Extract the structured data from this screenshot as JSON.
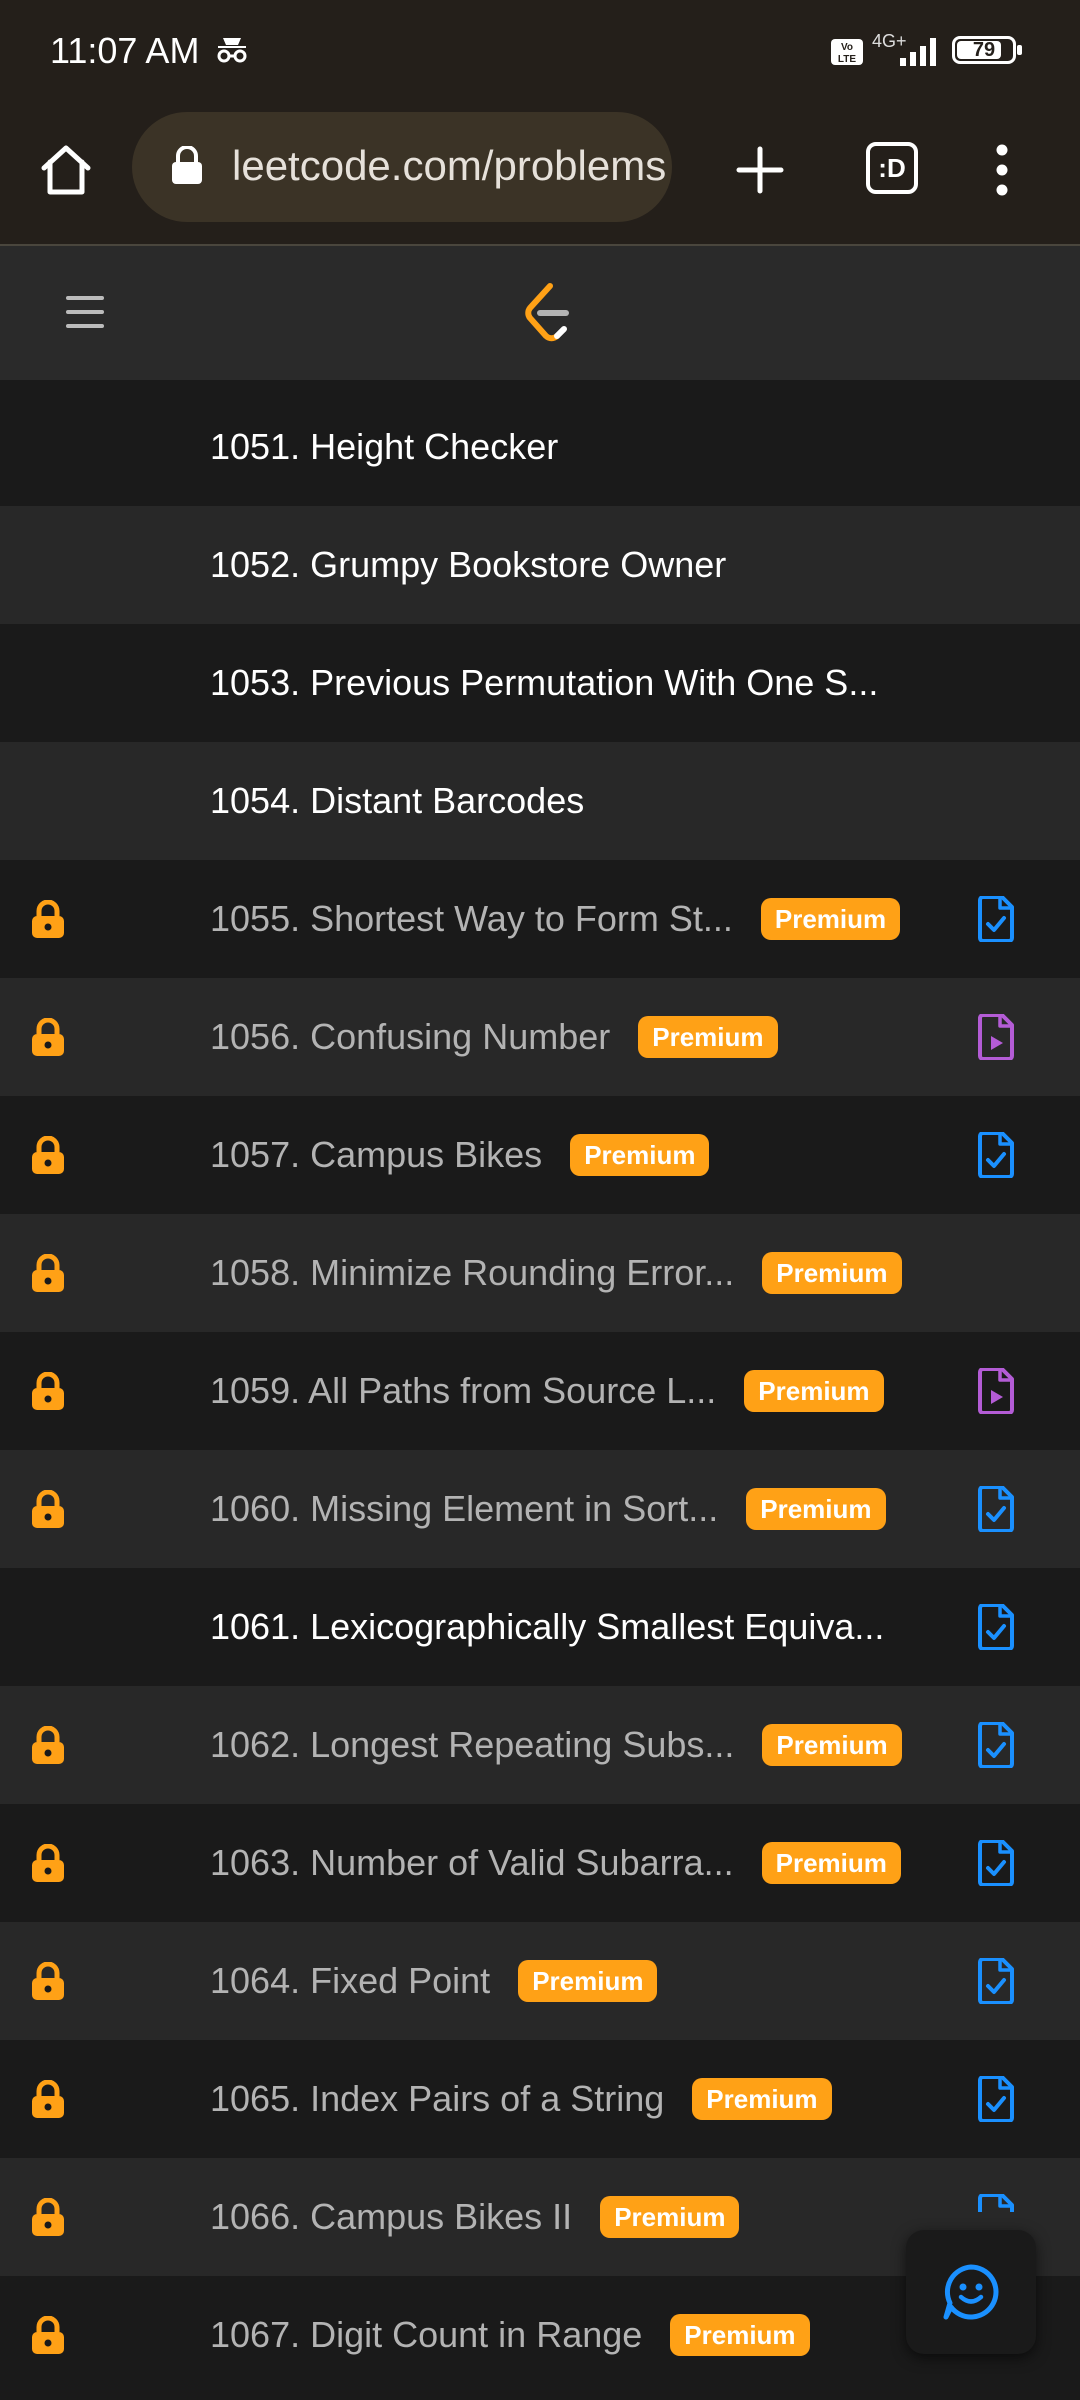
{
  "status_bar": {
    "time": "11:07 AM",
    "network": "4G+",
    "volte": "Vo LTE",
    "battery": "79"
  },
  "browser": {
    "url": "leetcode.com/problems",
    "tab_label": ":D"
  },
  "problems": [
    {
      "title": "1051. Height Checker",
      "premium": false,
      "badge": "",
      "solution": "none"
    },
    {
      "title": "1052. Grumpy Bookstore Owner",
      "premium": false,
      "badge": "",
      "solution": "none"
    },
    {
      "title": "1053. Previous Permutation With One S...",
      "premium": false,
      "badge": "",
      "solution": "none"
    },
    {
      "title": "1054. Distant Barcodes",
      "premium": false,
      "badge": "",
      "solution": "none"
    },
    {
      "title": "1055. Shortest Way to Form St...",
      "premium": true,
      "badge": "Premium",
      "solution": "article"
    },
    {
      "title": "1056. Confusing Number",
      "premium": true,
      "badge": "Premium",
      "solution": "video"
    },
    {
      "title": "1057. Campus Bikes",
      "premium": true,
      "badge": "Premium",
      "solution": "article"
    },
    {
      "title": "1058. Minimize Rounding Error...",
      "premium": true,
      "badge": "Premium",
      "solution": "none"
    },
    {
      "title": "1059. All Paths from Source L...",
      "premium": true,
      "badge": "Premium",
      "solution": "video"
    },
    {
      "title": "1060. Missing Element in Sort...",
      "premium": true,
      "badge": "Premium",
      "solution": "article"
    },
    {
      "title": "1061. Lexicographically Smallest Equiva...",
      "premium": false,
      "badge": "",
      "solution": "article"
    },
    {
      "title": "1062. Longest Repeating Subs...",
      "premium": true,
      "badge": "Premium",
      "solution": "article"
    },
    {
      "title": "1063. Number of Valid Subarra...",
      "premium": true,
      "badge": "Premium",
      "solution": "article"
    },
    {
      "title": "1064. Fixed Point",
      "premium": true,
      "badge": "Premium",
      "solution": "article"
    },
    {
      "title": "1065. Index Pairs of a String",
      "premium": true,
      "badge": "Premium",
      "solution": "article"
    },
    {
      "title": "1066. Campus Bikes II",
      "premium": true,
      "badge": "Premium",
      "solution": "article-partial"
    },
    {
      "title": "1067. Digit Count in Range",
      "premium": true,
      "badge": "Premium",
      "solution": "none"
    }
  ],
  "icons": {
    "lock": "lock-icon",
    "article": "article-check-icon",
    "video": "video-file-icon",
    "chat": "chat-smile-icon"
  },
  "colors": {
    "accent": "#ffa116",
    "article": "#1a90ff",
    "video": "#b45cd6"
  }
}
